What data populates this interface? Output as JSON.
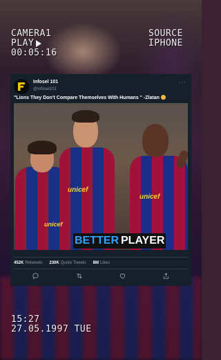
{
  "overlay": {
    "camera_label": "CAMERA1",
    "play_label": "PLAY",
    "timecode": "00:05:16",
    "source_label": "SOURCE",
    "source_value": "IPHONE",
    "time": "15:27",
    "date": "27.05.1997 TUE"
  },
  "tweet": {
    "display_name": "Infosel 101",
    "handle": "@Infosel101",
    "more_icon": "more-dots-icon",
    "text": "\"Lions They Don't Compare Themselves With Humans \" -Zlatan",
    "emoji_name": "grinning-face-emoji",
    "photo": {
      "sponsor": "unicef",
      "caption_part1": "BETTER",
      "caption_part2": "PLAYER"
    },
    "stats": {
      "retweets_count": "452K",
      "retweets_label": "Retweets",
      "quotes_count": "230K",
      "quotes_label": "Quote Tweets",
      "likes_count": "8M",
      "likes_label": "Likes"
    },
    "actions": [
      "reply-icon",
      "retweet-icon",
      "like-icon",
      "share-icon"
    ]
  },
  "colors": {
    "card_bg": "#15202b",
    "caption_accent": "#31a0ff",
    "barca_red": "#a1123a",
    "barca_blue": "#1c2f86",
    "sponsor_yellow": "#f6d23a"
  }
}
